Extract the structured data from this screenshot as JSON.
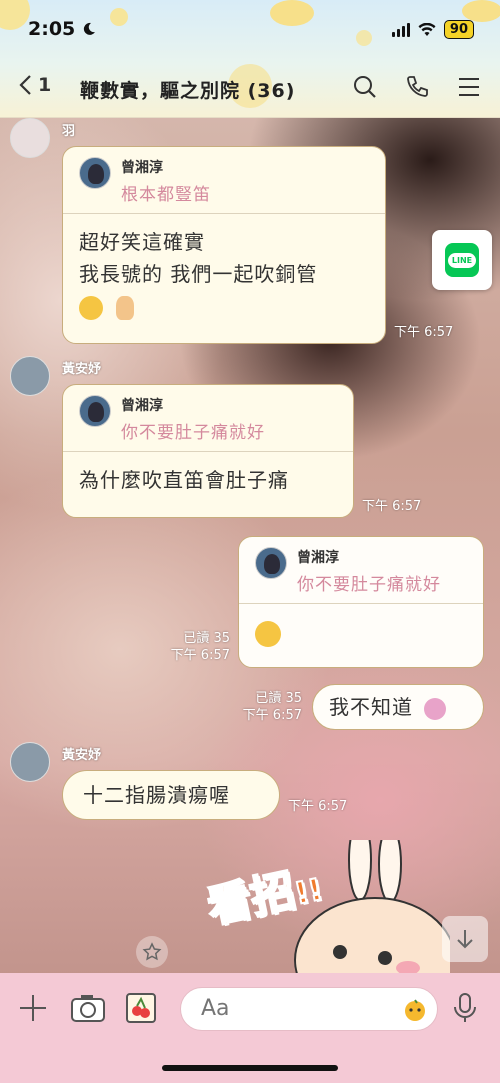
{
  "status": {
    "time": "2:05",
    "battery": "90"
  },
  "header": {
    "unread": "1",
    "title": "鞭數實，驅之別院 (36)"
  },
  "messages": {
    "m1": {
      "sender": "羽",
      "quote_name": "曾湘淳",
      "quote_text": "根本都豎笛",
      "line1": "超好笑這確實",
      "line2": "我長號的 我們一起吹銅管",
      "time": "下午 6:57"
    },
    "m2": {
      "sender": "黃安妤",
      "quote_name": "曾湘淳",
      "quote_text": "你不要肚子痛就好",
      "body": "為什麼吹直笛會肚子痛",
      "time": "下午 6:57"
    },
    "m3": {
      "quote_name": "曾湘淳",
      "quote_text": "你不要肚子痛就好",
      "read": "已讀 35",
      "time": "下午 6:57"
    },
    "m4": {
      "body": "我不知道",
      "read": "已讀 35",
      "time": "下午 6:57"
    },
    "m5": {
      "sender": "黃安妤",
      "body": "十二指腸潰瘍喔",
      "time": "下午 6:57"
    }
  },
  "share": {
    "logo": "LINE"
  },
  "sticker": {
    "text": "看招",
    "marks": "!!"
  },
  "input": {
    "placeholder": "Aa"
  },
  "icons": [
    "moon-icon",
    "signal-icon",
    "wifi-icon",
    "back-chevron-icon",
    "search-icon",
    "phone-icon",
    "menu-icon",
    "plus-icon",
    "camera-icon",
    "photo-icon",
    "emoji-icon",
    "mic-icon",
    "arrow-down-icon",
    "star-icon"
  ],
  "colors": {
    "quote_text": "#d4899d",
    "input_bar": "#f4c9d5",
    "line_green": "#06c755",
    "sticker_orange": "#f07b2e"
  }
}
